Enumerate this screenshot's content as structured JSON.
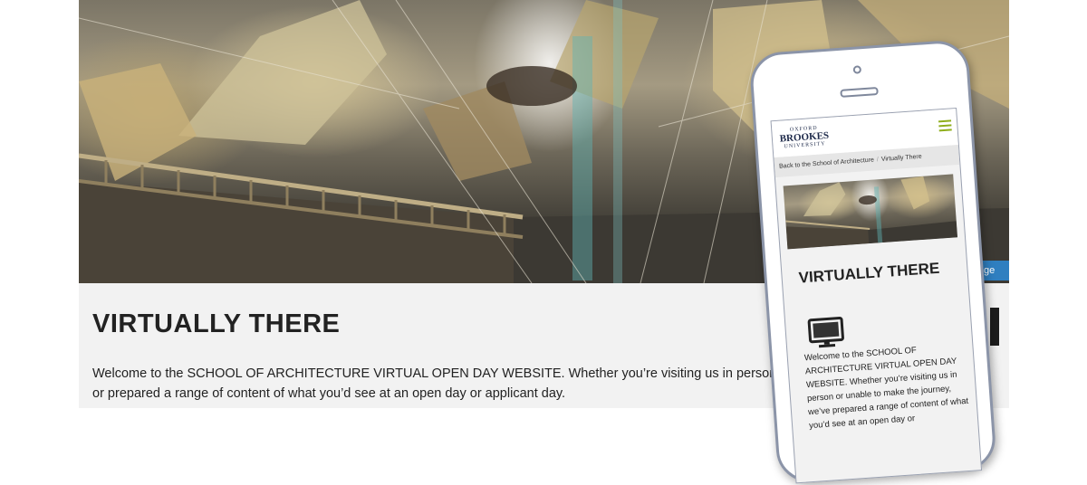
{
  "desktop": {
    "hero_badge": "ge",
    "title": "VIRTUALLY THERE",
    "intro": "Welcome to the SCHOOL OF ARCHITECTURE VIRTUAL OPEN DAY WEBSITE. Whether you’re visiting us in person or prepared a range of content of what you’d see at an open day or applicant day."
  },
  "mobile": {
    "logo": {
      "line1": "OXFORD",
      "line2": "BROOKES",
      "line3": "UNIVERSITY"
    },
    "menu_icon": "hamburger-icon",
    "breadcrumb": {
      "back": "Back to the School of Architecture",
      "separator": "/",
      "current": "Virtually There"
    },
    "title": "VIRTUALLY THERE",
    "section_icon": "monitor-icon",
    "intro": "Welcome to the SCHOOL OF ARCHITECTURE VIRTUAL OPEN DAY WEBSITE. Whether you’re visiting us in person or unable to make the journey, we’ve prepared a range of content of what you’d see at an open day or"
  },
  "colors": {
    "page_bg": "#f2f2f2",
    "text": "#222222",
    "brand_navy": "#1e2a4a",
    "menu_green": "#8fae1b",
    "badge_blue": "#2f7fc0",
    "phone_frame": "#8b94a8"
  }
}
